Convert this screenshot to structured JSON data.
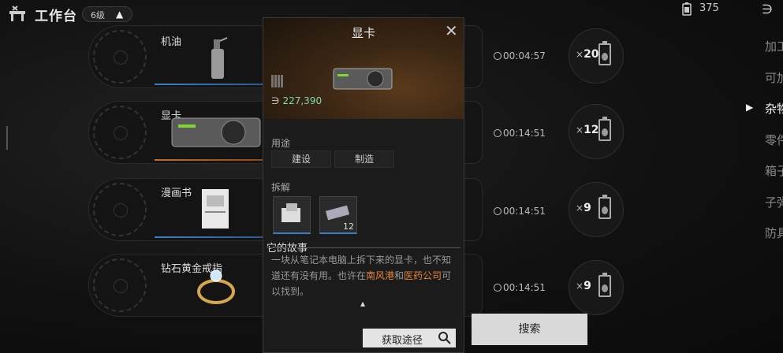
{
  "topbar": {
    "title": "工作台",
    "level": "6级",
    "level_up_icon": "chevron-up-icon",
    "currency_value": "375"
  },
  "rows": [
    {
      "name": "机油",
      "time": "00:04:57",
      "qty": "20"
    },
    {
      "name": "显卡",
      "time": "00:14:51",
      "qty": "12"
    },
    {
      "name": "漫画书",
      "time": "00:14:51",
      "qty": "9"
    },
    {
      "name": "钻石黄金戒指",
      "time": "00:14:51",
      "qty": "9"
    }
  ],
  "categories": [
    "加工",
    "可加",
    "杂物",
    "零件",
    "箱子",
    "子弹",
    "防具"
  ],
  "active_category": "杂物",
  "popup": {
    "title": "显卡",
    "price": "227,390",
    "use_label": "用途",
    "use_buttons": [
      "建设",
      "制造"
    ],
    "disassemble_label": "拆解",
    "disassemble_count": "12",
    "story_title": "它的故事",
    "story_part1": "一块从笔记本电脑上拆下来的显卡，也不知道还有没有用。也许在",
    "story_hl1": "南风港",
    "story_and": "和",
    "story_hl2": "医药公司",
    "story_end": "可以找到。",
    "source_button": "获取途径"
  },
  "search_button": "搜索",
  "colors": {
    "highlight": "#e8843a",
    "price": "#7fd6b0",
    "accent_blue": "#3a7fc4",
    "accent_orange": "#c46a2a"
  }
}
